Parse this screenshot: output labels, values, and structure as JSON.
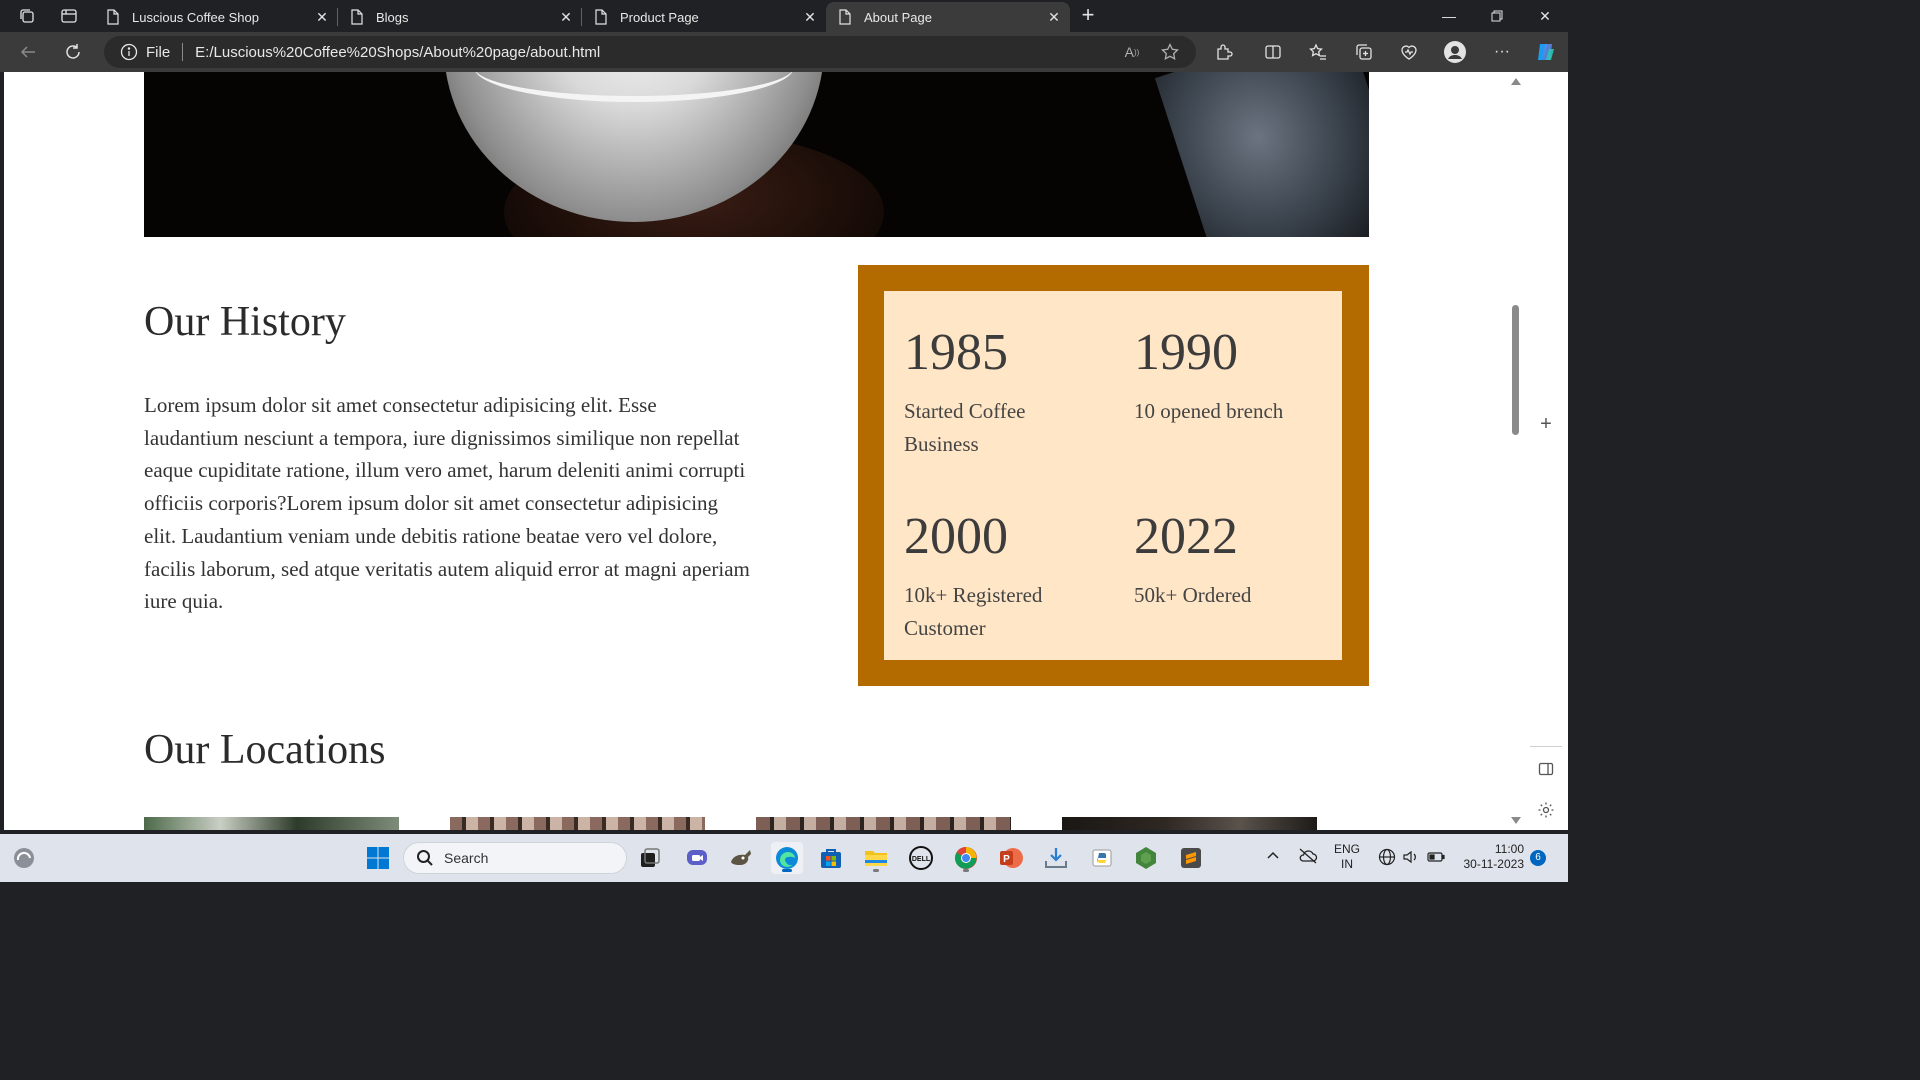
{
  "browser": {
    "tabs": [
      {
        "title": "Luscious Coffee Shop",
        "active": false
      },
      {
        "title": "Blogs",
        "active": false
      },
      {
        "title": "Product Page",
        "active": false
      },
      {
        "title": "About Page",
        "active": true
      }
    ],
    "address": {
      "scheme": "File",
      "url": "E:/Luscious%20Coffee%20Shops/About%20page/about.html"
    }
  },
  "page": {
    "history_title": "Our History",
    "history_text": "Lorem ipsum dolor sit amet consectetur adipisicing elit. Esse laudantium nesciunt a tempora, iure dignissimos similique non repellat eaque cupiditate ratione, illum vero amet, harum deleniti animi corrupti officiis corporis?Lorem ipsum dolor sit amet consectetur adipisicing elit. Laudantium veniam unde debitis ratione beatae vero vel dolore, facilis laborum, sed atque veritatis autem aliquid error at magni aperiam iure quia.",
    "stats": [
      {
        "year": "1985",
        "label": "Started Coffee Business"
      },
      {
        "year": "1990",
        "label": "10 opened brench"
      },
      {
        "year": "2000",
        "label": "10k+ Registered Customer"
      },
      {
        "year": "2022",
        "label": "50k+ Ordered"
      }
    ],
    "locations_title": "Our Locations"
  },
  "taskbar": {
    "search_placeholder": "Search",
    "language": "ENG",
    "region": "IN",
    "time": "11:00",
    "date": "30-11-2023",
    "notification_count": "6"
  },
  "colors": {
    "stats_border": "#b36b00",
    "stats_background": "#ffe6c6",
    "edge_blue": "#0067c0"
  }
}
